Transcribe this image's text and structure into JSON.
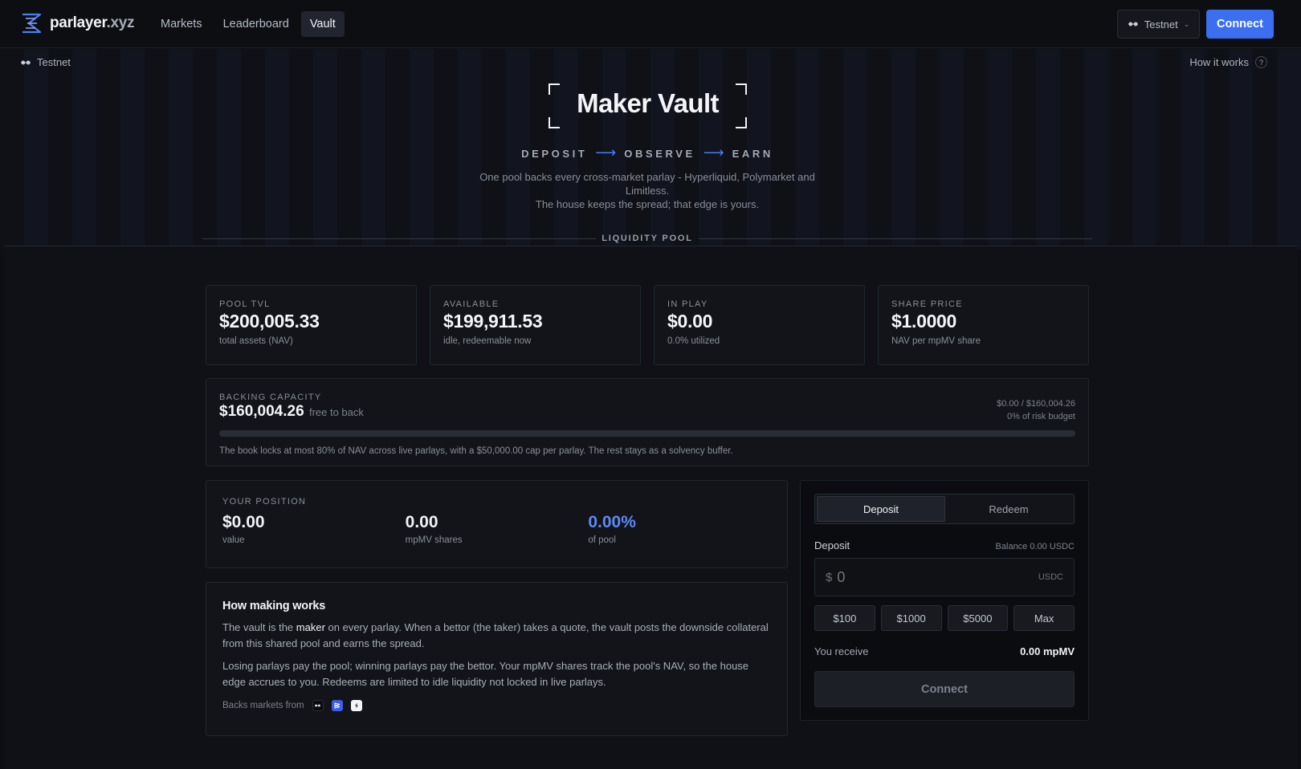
{
  "nav": {
    "brand": "parlayer",
    "brand_tld": ".xyz",
    "items": [
      {
        "label": "Markets",
        "active": false
      },
      {
        "label": "Leaderboard",
        "active": false
      },
      {
        "label": "Vault",
        "active": true
      }
    ],
    "network_label": "Testnet",
    "connect_label": "Connect"
  },
  "subbar": {
    "network": "Testnet",
    "how_it_works": "How it works",
    "how_icon": "?"
  },
  "hero": {
    "title": "Maker Vault",
    "steps": [
      "DEPOSIT",
      "OBSERVE",
      "EARN"
    ],
    "desc_line1": "One pool backs every cross-market parlay - Hyperliquid, Polymarket and Limitless.",
    "desc_line2": "The house keeps the spread; that edge is yours.",
    "section_label": "LIQUIDITY POOL"
  },
  "stats": [
    {
      "label": "POOL TVL",
      "value": "$200,005.33",
      "sub": "total assets (NAV)"
    },
    {
      "label": "AVAILABLE",
      "value": "$199,911.53",
      "sub": "idle, redeemable now"
    },
    {
      "label": "IN PLAY",
      "value": "$0.00",
      "sub": "0.0% utilized"
    },
    {
      "label": "SHARE PRICE",
      "value": "$1.0000",
      "sub": "NAV per mpMV share"
    }
  ],
  "capacity": {
    "label": "BACKING CAPACITY",
    "value": "$160,004.26",
    "free_label": "free to back",
    "used_of_total": "$0.00 / $160,004.26",
    "risk_budget": "0% of risk budget",
    "fill_fraction": 0,
    "note": "The book locks at most 80% of NAV across live parlays, with a $50,000.00 cap per parlay. The rest stays as a solvency buffer."
  },
  "position": {
    "label": "YOUR POSITION",
    "items": [
      {
        "value": "$0.00",
        "sub": "value"
      },
      {
        "value": "0.00",
        "sub": "mpMV shares"
      },
      {
        "value": "0.00%",
        "sub": "of pool"
      }
    ]
  },
  "how": {
    "title": "How making works",
    "p1_a": "The vault is the ",
    "p1_hl": "maker",
    "p1_b": " on every parlay. When a bettor (the taker) takes a quote, the vault posts the downside collateral from this shared pool and earns the spread.",
    "p2": "Losing parlays pay the pool; winning parlays pay the bettor. Your mpMV shares track the pool's NAV, so the house edge accrues to you. Redeems are limited to idle liquidity not locked in live parlays.",
    "backs_label": "Backs markets from"
  },
  "panel": {
    "tabs": [
      {
        "label": "Deposit",
        "active": true
      },
      {
        "label": "Redeem",
        "active": false
      }
    ],
    "deposit_label": "Deposit",
    "balance": "Balance 0.00 USDC",
    "currency_symbol": "$",
    "amount_placeholder": "0",
    "unit": "USDC",
    "quick": [
      "$100",
      "$1000",
      "$5000",
      "Max"
    ],
    "receive_label": "You receive",
    "receive_value": "0.00 mpMV",
    "connect_label": "Connect"
  },
  "colors": {
    "accent": "#3b6ef0",
    "accent_text": "#5b8af6",
    "background": "#0d0f14"
  }
}
